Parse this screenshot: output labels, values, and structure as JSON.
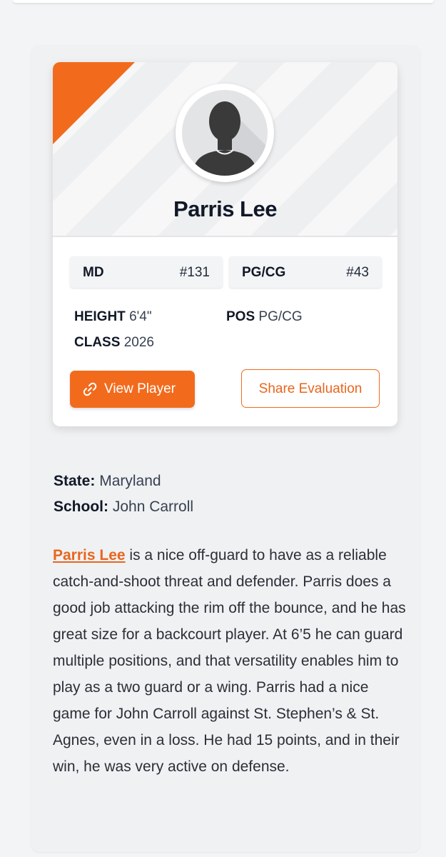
{
  "player": {
    "name": "Parris Lee",
    "state_code": "MD",
    "state_rank": "#131",
    "position_badge": "PG/CG",
    "position_rank": "#43",
    "height_label": "HEIGHT",
    "height_value": "6'4\"",
    "pos_label": "POS",
    "pos_value": "PG/CG",
    "class_label": "CLASS",
    "class_value": "2026"
  },
  "actions": {
    "view_label": "View Player",
    "share_label": "Share Evaluation"
  },
  "details": {
    "state_label": "State:",
    "state_value": "Maryland",
    "school_label": "School:",
    "school_value": "John Carroll"
  },
  "article": {
    "link_text": "Parris Lee",
    "body": " is a nice off-guard to have as a reliable catch-and-shoot threat and defender. Parris does a good job attacking the rim off the bounce, and he has great size for a backcourt player. At 6’5 he can guard multiple positions, and that versatility enables him to play as a two guard or a wing. Parris had a nice game for John Carroll against St. Stephen’s & St. Agnes, even in a loss. He had 15 points, and in their win, he was very active on defense."
  },
  "icons": {
    "avatar": "person-silhouette-icon",
    "view_button": "link-icon"
  },
  "colors": {
    "accent": "#f26b1d",
    "text": "#111827"
  }
}
